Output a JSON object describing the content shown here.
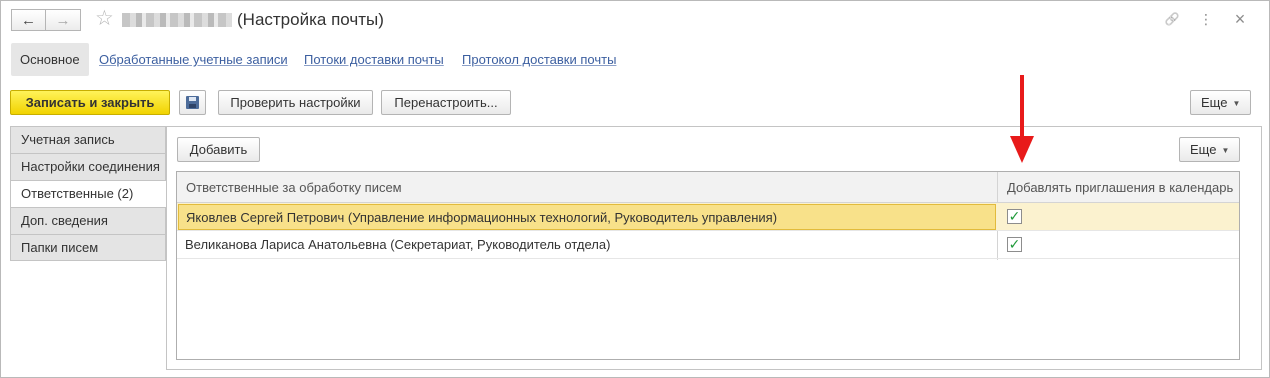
{
  "window": {
    "title": "(Настройка почты)",
    "back_icon": "←",
    "forward_icon": "→",
    "star_icon": "☆",
    "link_icon": "🔗",
    "more_icon": "⋮",
    "close_icon": "×"
  },
  "tabs": {
    "main": "Основное",
    "links": [
      "Обработанные учетные записи",
      "Потоки доставки почты",
      "Протокол доставки почты"
    ]
  },
  "toolbar": {
    "save_close": "Записать и закрыть",
    "check_settings": "Проверить настройки",
    "reconfigure": "Перенастроить...",
    "more": "Еще"
  },
  "side_tabs": [
    "Учетная запись",
    "Настройки соединения",
    "Ответственные (2)",
    "Доп. сведения",
    "Папки писем"
  ],
  "active_side_tab": "Ответственные (2)",
  "panel": {
    "add_button": "Добавить",
    "more_button": "Еще",
    "columns": [
      "Ответственные за обработку писем",
      "Добавлять приглашения в календарь"
    ],
    "rows": [
      {
        "name": "Яковлев Сергей Петрович (Управление информационных технологий, Руководитель управления)",
        "checked": true,
        "selected": true
      },
      {
        "name": "Великанова Лариса Анатольевна (Секретариат, Руководитель отдела)",
        "checked": true,
        "selected": false
      }
    ],
    "check_glyph": "✓"
  },
  "colors": {
    "primary_button": "#f1d300",
    "annotation_arrow": "#e81a1a",
    "link": "#3c5fa0",
    "selected_cell": "#f8e18a"
  }
}
